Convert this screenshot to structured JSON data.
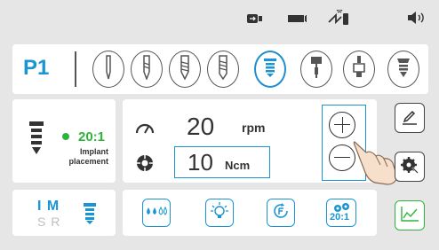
{
  "program": {
    "label": "P1"
  },
  "ratio": {
    "value": "20:1",
    "status_color": "#2db53b",
    "mode_line1": "Implant",
    "mode_line2": "placement"
  },
  "speed": {
    "value": "20",
    "unit": "rpm"
  },
  "torque": {
    "value": "10",
    "unit": "Ncm"
  },
  "modes": {
    "active": "I M",
    "inactive": "S R"
  },
  "bottom": {
    "ratio_badge": "20:1"
  },
  "colors": {
    "accent": "#1a95d4",
    "green": "#2db53b",
    "dark": "#333333"
  },
  "icons": {
    "status": [
      "usb-icon",
      "battery-icon",
      "wireless-charge-icon",
      "volume-icon"
    ],
    "steps": [
      "pilot-drill-icon",
      "twist-drill-icon",
      "drill-2-icon",
      "drill-3-icon",
      "implant-icon",
      "tap-icon",
      "cover-screw-icon",
      "abutment-icon"
    ]
  }
}
